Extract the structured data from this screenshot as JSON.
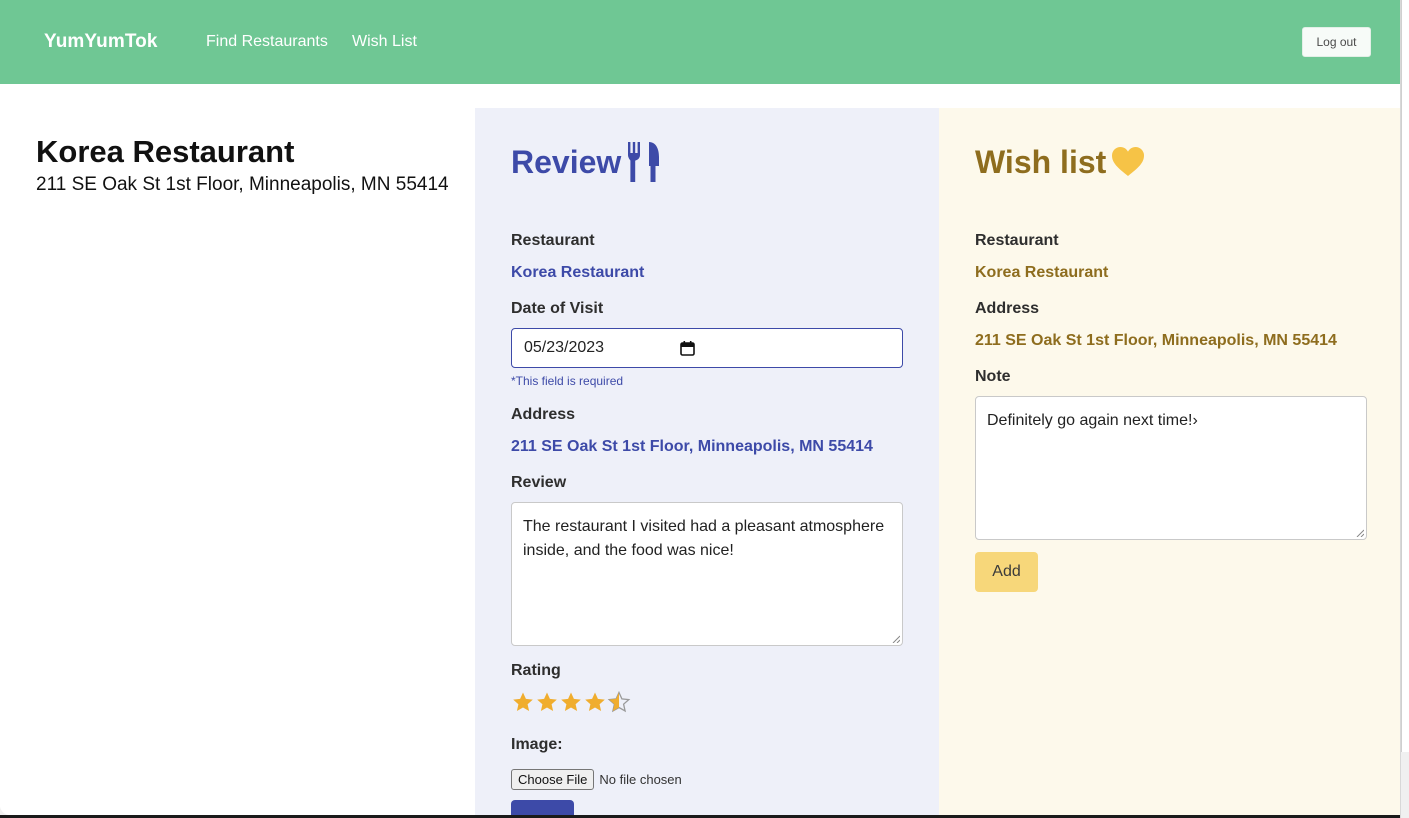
{
  "navbar": {
    "brand": "YumYumTok",
    "links": [
      "Find Restaurants",
      "Wish List"
    ],
    "logout_label": "Log out",
    "color": "#6fc794"
  },
  "restaurant_info": {
    "name": "Korea Restaurant",
    "address": "211 SE Oak St 1st Floor, Minneapolis, MN 55414"
  },
  "review": {
    "title": "Review",
    "title_icon": "fork-knife-icon",
    "accent": "#3d4aa8",
    "restaurant_label": "Restaurant",
    "restaurant_value": "Korea Restaurant",
    "date_label": "Date of Visit",
    "date_value": "05/23/2023",
    "required_note": "*This field is required",
    "address_label": "Address",
    "address_value": "211 SE Oak St 1st Floor, Minneapolis, MN 55414",
    "review_label": "Review",
    "review_text": "The restaurant I visited had a pleasant atmosphere inside, and the food was nice!",
    "rating_label": "Rating",
    "rating_value": 4.5,
    "rating_max": 5,
    "image_label": "Image:",
    "file_button": "Choose File",
    "file_status": "No file chosen"
  },
  "wishlist": {
    "title": "Wish list",
    "title_icon": "heart-icon",
    "accent": "#8e6d1e",
    "restaurant_label": "Restaurant",
    "restaurant_value": "Korea Restaurant",
    "address_label": "Address",
    "address_value": "211 SE Oak St 1st Floor, Minneapolis, MN 55414",
    "note_label": "Note",
    "note_text": "Definitely go again next time!›",
    "add_label": "Add"
  }
}
